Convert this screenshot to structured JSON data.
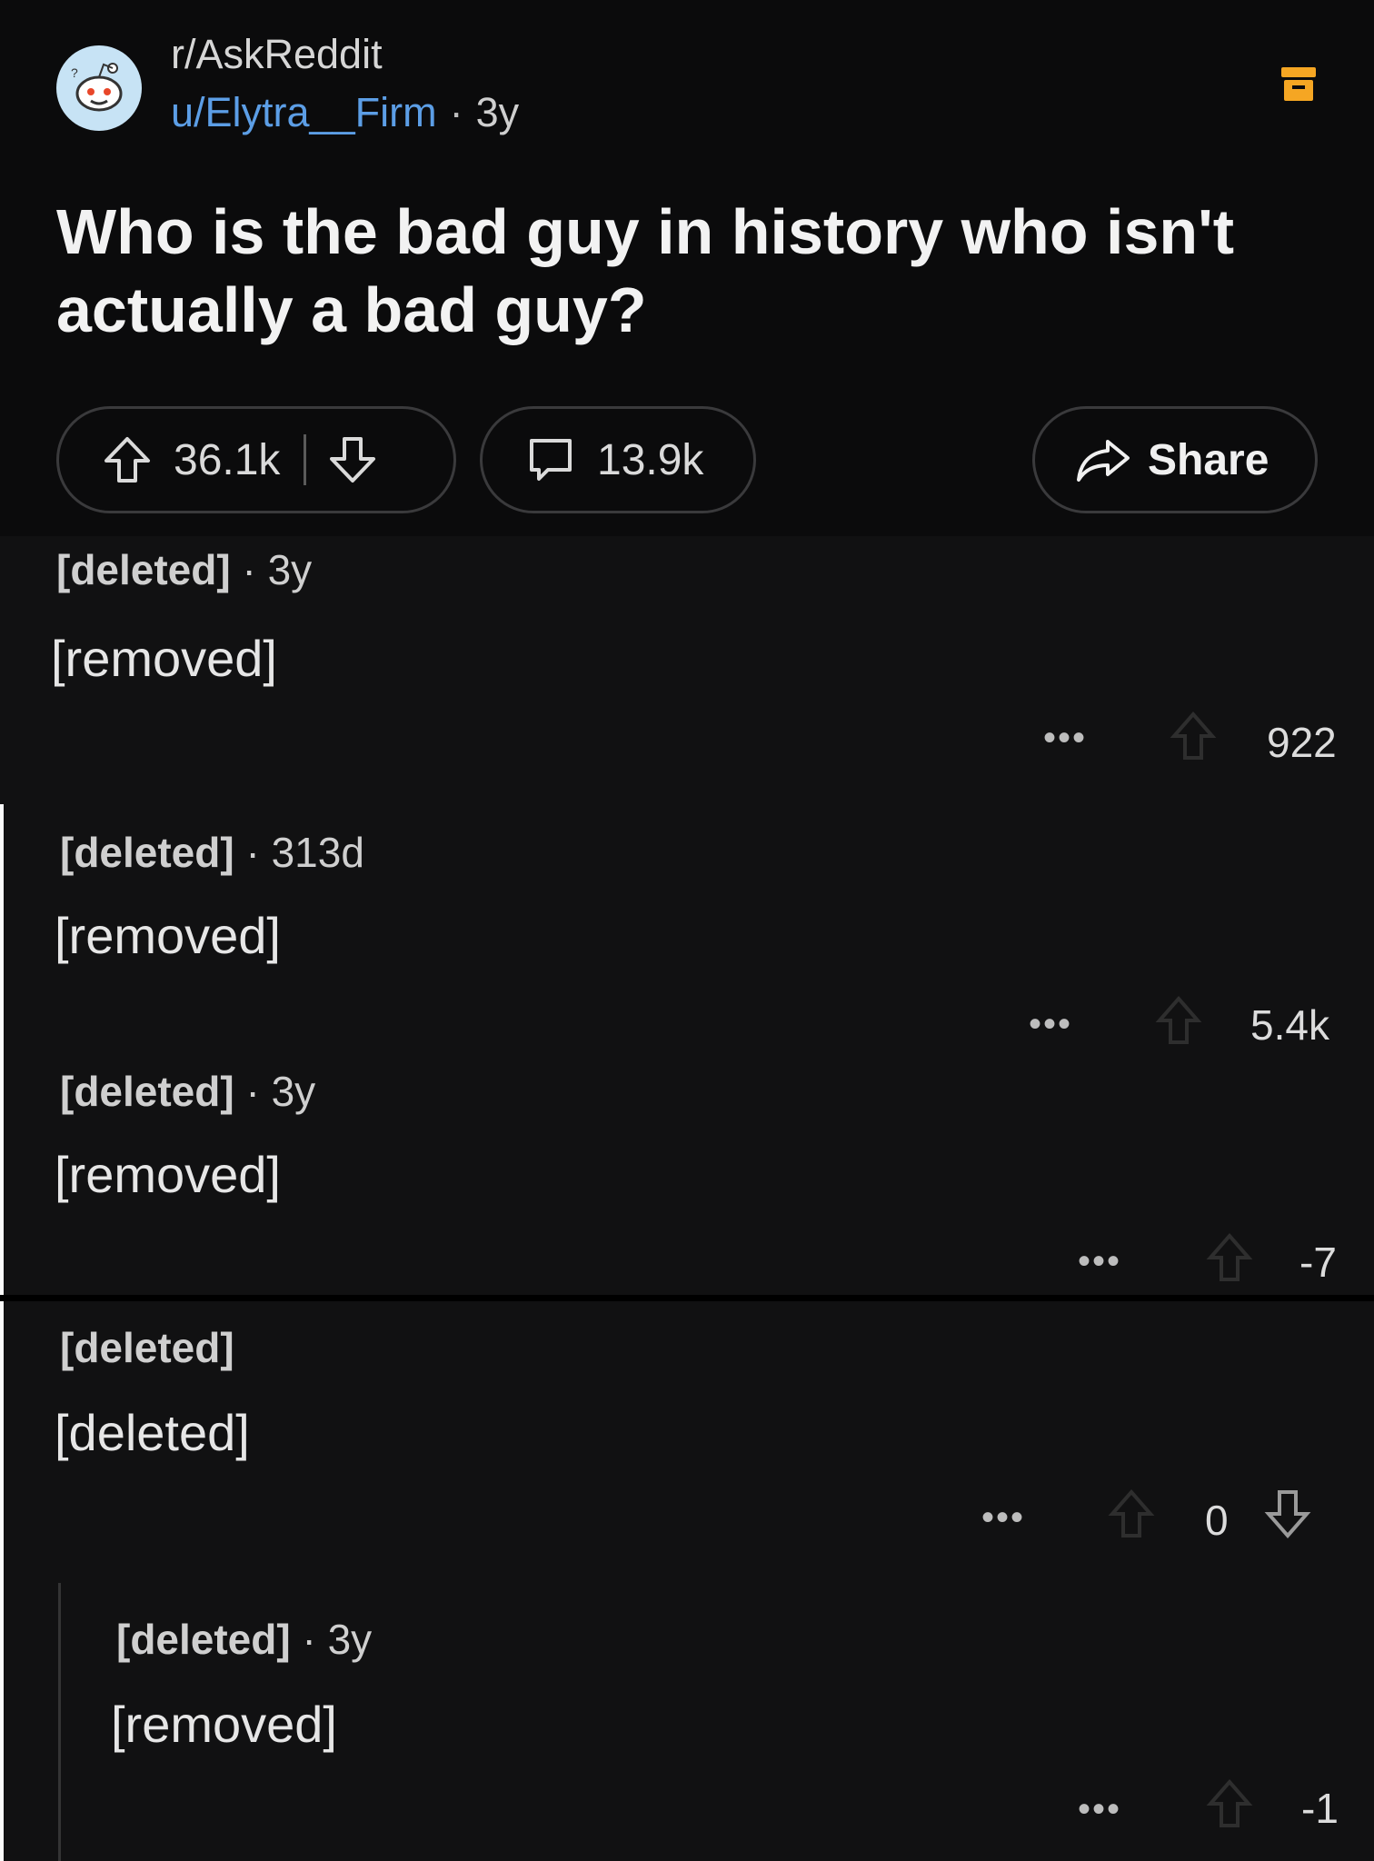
{
  "post": {
    "subreddit": "r/AskReddit",
    "author": "u/Elytra__Firm",
    "age": "3y",
    "title": "Who is the bad guy in history who isn't actually a bad guy?",
    "upvotes": "36.1k",
    "comments": "13.9k",
    "share_label": "Share",
    "icons": [
      "snoo-avatar",
      "archive-icon",
      "upvote-icon",
      "downvote-icon",
      "comment-icon",
      "share-icon"
    ]
  },
  "comments": [
    {
      "author": "[deleted]",
      "age": "3y",
      "body": "[removed]",
      "score": "922"
    },
    {
      "author": "[deleted]",
      "age": "313d",
      "body": "[removed]",
      "score": "5.4k"
    },
    {
      "author": "[deleted]",
      "age": "3y",
      "body": "[removed]",
      "score": "-7"
    },
    {
      "author": "[deleted]",
      "age": "",
      "body": "[deleted]",
      "score": "0"
    },
    {
      "author": "[deleted]",
      "age": "3y",
      "body": "[removed]",
      "score": "-1"
    }
  ],
  "colors": {
    "background": "#111112",
    "username": "#5c9ee6",
    "archive": "#f5a623"
  }
}
